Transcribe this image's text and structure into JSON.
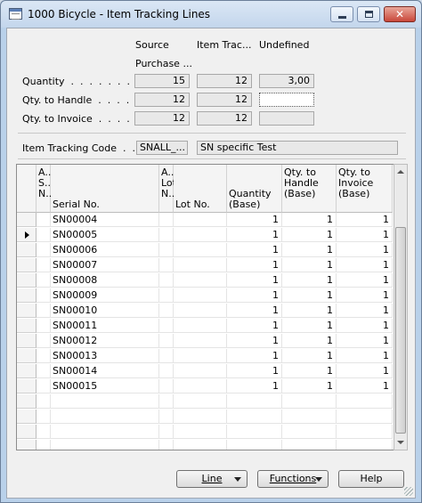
{
  "window": {
    "title": "1000 Bicycle - Item Tracking Lines",
    "close_label": "✕"
  },
  "header": {
    "columns": [
      "Source",
      "Item Trac...",
      "Undefined"
    ],
    "source_subheader": "Purchase ...",
    "rows": [
      {
        "label": "Quantity  .  .  .  .  .  .  .  .",
        "source": "15",
        "item_tracking": "12",
        "undefined": "3,00"
      },
      {
        "label": "Qty. to Handle  .  .  .  .  .",
        "source": "12",
        "item_tracking": "12",
        "undefined": ""
      },
      {
        "label": "Qty. to Invoice  .  .  .  .  .",
        "source": "12",
        "item_tracking": "12",
        "undefined": ""
      }
    ],
    "item_tracking_code_label": "Item Tracking Code  .  .  .",
    "item_tracking_code_value": "SNALL_...",
    "item_tracking_code_description": "SN specific Test"
  },
  "grid": {
    "columns": {
      "col1": [
        "A...",
        "S...",
        "N..."
      ],
      "serial_no": "Serial No.",
      "col3": [
        "A...",
        "Lot",
        "N..."
      ],
      "lot_no": "Lot No.",
      "quantity_base": [
        "Quantity",
        "(Base)"
      ],
      "qty_to_handle_base": [
        "Qty. to",
        "Handle",
        "(Base)"
      ],
      "qty_to_invoice_base": [
        "Qty. to",
        "Invoice",
        "(Base)"
      ]
    },
    "rows": [
      {
        "serial": "SN00004",
        "quantity": "1",
        "handle": "1",
        "invoice": "1"
      },
      {
        "serial": "SN00005",
        "quantity": "1",
        "handle": "1",
        "invoice": "1",
        "current": true
      },
      {
        "serial": "SN00006",
        "quantity": "1",
        "handle": "1",
        "invoice": "1"
      },
      {
        "serial": "SN00007",
        "quantity": "1",
        "handle": "1",
        "invoice": "1"
      },
      {
        "serial": "SN00008",
        "quantity": "1",
        "handle": "1",
        "invoice": "1"
      },
      {
        "serial": "SN00009",
        "quantity": "1",
        "handle": "1",
        "invoice": "1"
      },
      {
        "serial": "SN00010",
        "quantity": "1",
        "handle": "1",
        "invoice": "1"
      },
      {
        "serial": "SN00011",
        "quantity": "1",
        "handle": "1",
        "invoice": "1"
      },
      {
        "serial": "SN00012",
        "quantity": "1",
        "handle": "1",
        "invoice": "1"
      },
      {
        "serial": "SN00013",
        "quantity": "1",
        "handle": "1",
        "invoice": "1"
      },
      {
        "serial": "SN00014",
        "quantity": "1",
        "handle": "1",
        "invoice": "1"
      },
      {
        "serial": "SN00015",
        "quantity": "1",
        "handle": "1",
        "invoice": "1"
      }
    ],
    "empty_rows": 4
  },
  "buttons": {
    "line": "Line",
    "functions": "Functions",
    "help": "Help"
  },
  "icons": [
    "app-icon",
    "minimize-icon",
    "maximize-icon",
    "close-icon",
    "row-pointer-icon",
    "scroll-up-icon",
    "scroll-down-icon",
    "dropdown-arrow-icon"
  ]
}
